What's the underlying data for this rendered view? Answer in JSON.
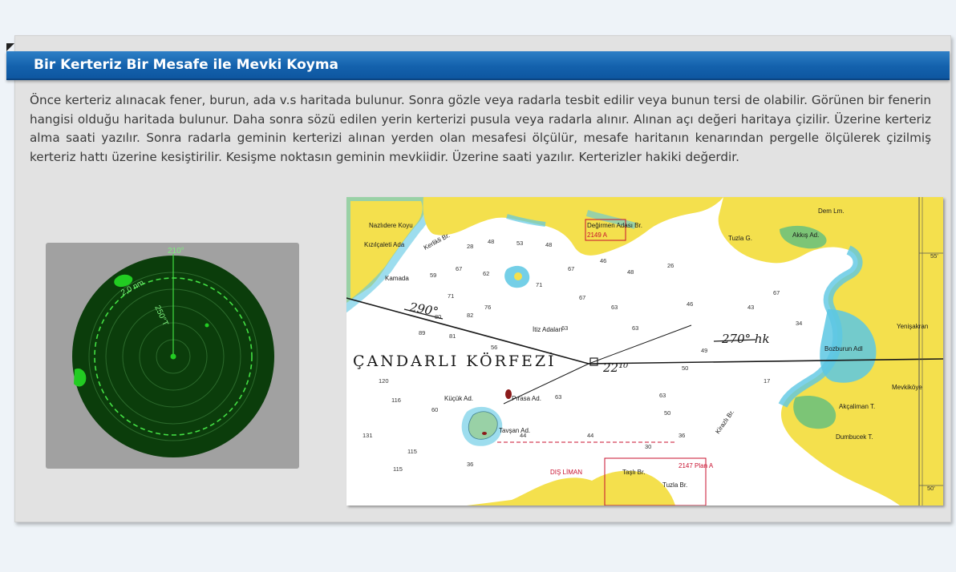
{
  "lesson": {
    "title": "Bir Kerteriz Bir Mesafe ile Mevki Koyma",
    "paragraph": "Önce kerteriz alınacak fener, burun, ada v.s haritada bulunur. Sonra gözle veya radarla tesbit edilir veya bunun tersi de olabilir. Görünen bir fenerin hangisi olduğu haritada bulunur. Daha sonra sözü edilen yerin kerterizi pusula veya radarla alınır. Alınan açı değeri haritaya çizilir. Üzerine kerteriz alma saati yazılır. Sonra radarla geminin kerterizi alınan yerden olan mesafesi ölçülür, mesafe haritanın kenarından pergelle ölçülerek çizilmiş kerteriz hattı üzerine kesiştirilir. Kesişme noktasın geminin mevkiidir. Üzerine saati yazılır. Kerterizler hakiki değerdir."
  },
  "radar": {
    "bearing_label": "210°",
    "range_label": "2,0 nm",
    "bearing_line_label": "250°T",
    "colors": {
      "scope": "#0b3d0b",
      "echo": "#22cc22",
      "frame": "#a1a1a1"
    }
  },
  "nautical_chart": {
    "gulf_name": "ÇANDARLI KÖRFEZİ",
    "bearing_1": "290°",
    "bearing_2": "270° hk",
    "fix_time": "22¹⁰",
    "places": {
      "nazli": "Nazlıdere Koyu",
      "kizilcaleti": "Kızılçaleti Ada",
      "kamada": "Kamada",
      "kerlikli": "Kerlikli Br.",
      "degirmen": "Değirmen Adası Br.",
      "itiz": "İtiz Adaları",
      "kucuk": "Küçük Ad.",
      "pirasa": "Pırasa Ad.",
      "tavsan": "Tavşan Ad.",
      "dis_liman": "DIŞ LİMAN",
      "tasli": "Taşlı Br.",
      "tuzla_br": "Tuzla Br.",
      "dem": "Dem Lm.",
      "akkis": "Akkış Ad.",
      "tuzla_g": "Tuzla G.",
      "bozburun": "Bozburun Adl",
      "yenisakran": "Yenişakran",
      "mevkikoye": "Mevkiköye",
      "dumbucek": "Dumbucek T.",
      "akcaliman": "Akçaliman T.",
      "kirazli": "Kirazlı Br.",
      "ref1": "2149 A",
      "ref2": "2147 Plan A",
      "lat1": "55'",
      "lat2": "50'"
    },
    "colors": {
      "sea": "#ffffff",
      "shallow": "#5cc7e3",
      "land": "#f4e04d",
      "green": "#7cc576",
      "bearing": "#1a1a1a"
    }
  }
}
